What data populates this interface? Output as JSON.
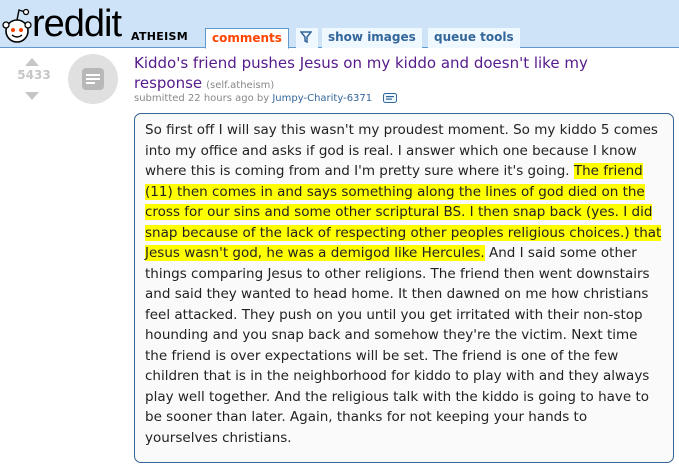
{
  "header": {
    "logo_text": "reddit",
    "subreddit": "ATHEISM",
    "tabs": [
      {
        "label": "comments",
        "selected": true
      },
      {
        "label": "show images"
      },
      {
        "label": "queue tools"
      }
    ],
    "filter_icon": "filter-icon"
  },
  "post": {
    "score": "5433",
    "title": "Kiddo's friend pushes Jesus on my kiddo and doesn't like my response",
    "domain": "(self.atheism)",
    "submitted_prefix": "submitted 22 hours ago by",
    "author": "Jumpy-Charity-6371",
    "thumbnail_icon": "self-text-icon",
    "expando_icon": "expando-icon"
  },
  "selftext": {
    "part_before": "So first off I will say this wasn't my proudest moment. So my kiddo 5 comes into my office and asks if god is real. I answer which one because I know where this is coming from and I'm pretty sure where it's going. ",
    "part_highlight": "The friend (11) then comes in and says something along the lines of god died on the cross for our sins and some other scriptural BS. I then snap back (yes. I did snap because of the lack of respecting other peoples religious choices.) that Jesus wasn't god, he was a demigod like Hercules.",
    "part_after": " And I said some other things comparing Jesus to other religions. The friend then went downstairs and said they wanted to head home. It then dawned on me how christians feel attacked. They push on you until you get irritated with their non-stop hounding and you snap back and somehow they're the victim. Next time the friend is over expectations will be set. The friend is one of the few children that is in the neighborhood for kiddo to play with and they always play well together. And the religious talk with the kiddo is going to have to be sooner than later. Again, thanks for not keeping your hands to yourselves christians.",
    "highlight_color": "#ffff00"
  },
  "colors": {
    "header_bg": "#cee3f8",
    "tab_selected": "#ff4500",
    "link": "#369",
    "title_visited": "#551a8b"
  }
}
